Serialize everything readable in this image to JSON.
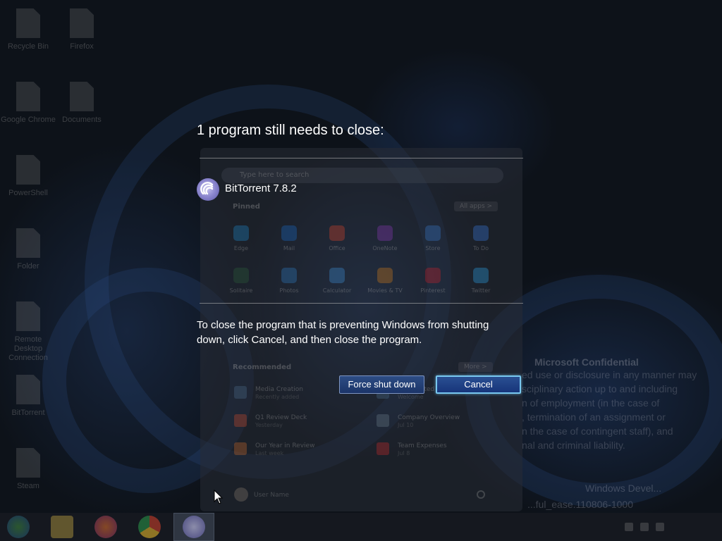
{
  "desktop": {
    "icons": [
      {
        "label": "Recycle Bin"
      },
      {
        "label": "Firefox"
      },
      {
        "label": "Google Chrome"
      },
      {
        "label": "Documents"
      },
      {
        "label": "PowerShell"
      },
      {
        "label": "Folder"
      },
      {
        "label": "Remote Desktop Connection"
      },
      {
        "label": "BitTorrent"
      },
      {
        "label": "Steam"
      }
    ],
    "start_menu": {
      "search_placeholder": "Type here to search",
      "pinned_title": "Pinned",
      "all_apps": "All apps >",
      "pinned_apps": [
        {
          "name": "Edge",
          "color": "#1e88c8"
        },
        {
          "name": "Mail",
          "color": "#1b6bc6"
        },
        {
          "name": "Office",
          "color": "#d8442a"
        },
        {
          "name": "OneNote",
          "color": "#8a3ab8"
        },
        {
          "name": "Store",
          "color": "#3a78c8"
        },
        {
          "name": "To Do",
          "color": "#3a7be0"
        },
        {
          "name": "Solitaire",
          "color": "#2a5e3a"
        },
        {
          "name": "Photos",
          "color": "#2e7cc4"
        },
        {
          "name": "Calculator",
          "color": "#3f8fd8"
        },
        {
          "name": "Movies & TV",
          "color": "#d07a1a"
        },
        {
          "name": "Pinterest",
          "color": "#c8202a"
        },
        {
          "name": "Twitter",
          "color": "#2aa4e8"
        }
      ],
      "recommended_title": "Recommended",
      "more": "More >",
      "recommended": [
        {
          "name": "Media Creation",
          "sub": "Recently added"
        },
        {
          "name": "Get Started",
          "sub": "Welcome"
        },
        {
          "name": "Q1 Review Deck",
          "sub": "Yesterday"
        },
        {
          "name": "Company Overview",
          "sub": "Jul 10"
        },
        {
          "name": "Our Year in Review",
          "sub": "Last week"
        },
        {
          "name": "Team Expenses",
          "sub": "Jul 8"
        }
      ],
      "username": "User Name"
    },
    "watermark": {
      "title": "Microsoft Confidential",
      "lines": [
        "ed use or disclosure in any manner may",
        "sciplinary action up to and including",
        "n of employment (in the case of",
        ", termination of an assignment or",
        "n the case of contingent staff), and",
        "nal and criminal liability."
      ],
      "edition": "Windows Devel...",
      "build": "...ful_ease.110806-1000"
    }
  },
  "dialog": {
    "title": "1 program still needs to close:",
    "program": {
      "name": "BitTorrent 7.8.2",
      "icon": "bittorrent-icon"
    },
    "message": "To close the program that is preventing Windows from shutting down, click Cancel, and then close the program.",
    "buttons": {
      "force": "Force shut down",
      "cancel": "Cancel"
    }
  },
  "colors": {
    "overlay": "#0b0f16",
    "button_focus_border": "#78c7ef",
    "button_fill": "#1b3468",
    "text": "#ffffff"
  }
}
